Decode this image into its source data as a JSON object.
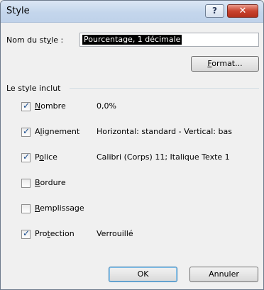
{
  "window": {
    "title": "Style",
    "help_label": "?",
    "close_label": "✕"
  },
  "name_field": {
    "label_pre": "Nom du st",
    "label_ul": "y",
    "label_post": "le :",
    "value": "Pourcentage, 1 décimale"
  },
  "format_button": {
    "label_ul": "F",
    "label_rest": "ormat..."
  },
  "group": {
    "label": "Le style inclut"
  },
  "items": [
    {
      "pre": "",
      "ul": "N",
      "post": "ombre",
      "checked": true,
      "value": "0,0%"
    },
    {
      "pre": "A",
      "ul": "l",
      "post": "ignement",
      "checked": true,
      "value": "Horizontal: standard - Vertical: bas"
    },
    {
      "pre": "P",
      "ul": "o",
      "post": "lice",
      "checked": true,
      "value": "Calibri (Corps) 11; Italique Texte 1"
    },
    {
      "pre": "",
      "ul": "B",
      "post": "ordure",
      "checked": false,
      "value": ""
    },
    {
      "pre": "",
      "ul": "R",
      "post": "emplissage",
      "checked": false,
      "value": ""
    },
    {
      "pre": "Pro",
      "ul": "t",
      "post": "ection",
      "checked": true,
      "value": "Verrouillé"
    }
  ],
  "buttons": {
    "ok": "OK",
    "cancel": "Annuler"
  },
  "checkmark": "✓",
  "colors": {
    "titlebar": "#c4d6ec",
    "close_button": "#c9432e",
    "dialog_bg": "#f0f0f0",
    "selection": "#000000"
  }
}
